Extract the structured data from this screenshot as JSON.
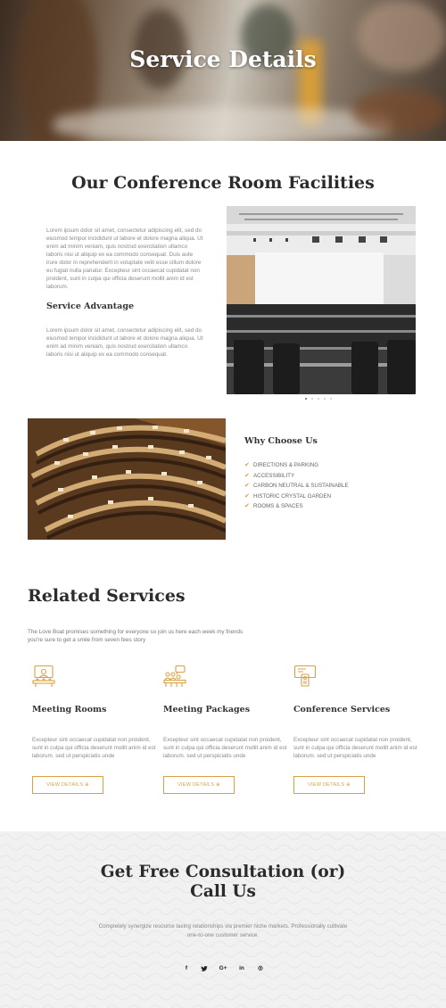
{
  "hero": {
    "title": "Service Details"
  },
  "facilities": {
    "title": "Our Conference Room Facilities",
    "intro": "Lorem ipsum dolor sit amet, consectetur adipiscing elit, sed do eiusmod tempor incididunt ut labore et dolore magna aliqua. Ut enim ad minim veniam, quis nostrud exercitation ullamco laboris nisi ut aliquip ex ea commodo consequat. Duis aute irure dolor in reprehenderit in voluptate velit esse cillum dolore eu fugiat nulla pariatur. Excepteur sint occaecat cupidatat non proident, sunt in culpa qui officia deserunt mollit anim id est laborum.",
    "advantage_title": "Service Advantage",
    "advantage_text": "Lorem ipsum dolor sit amet, consectetur adipiscing elit, sed do eiusmod tempor incididunt ut labore et dolore magna aliqua. Ut enim ad minim veniam, quis nostrud exercitation ullamco laboris nisi ut aliquip ex ea commodo consequat.",
    "slider_dots": 5,
    "slider_active": 0
  },
  "why": {
    "title": "Why Choose Us",
    "items": [
      "DIRECTIONS & PARKING",
      "ACCESSIBILITY",
      "CARBON NEUTRAL & SUSTAINABLE",
      "HISTORIC CRYSTAL GARDEN",
      "ROOMS & SPACES"
    ]
  },
  "related": {
    "title": "Related Services",
    "intro": "The Love Boat promises something for everyone so join us here each week my friends you're sure to get a smile from seven fees story",
    "cards": [
      {
        "icon": "meeting-room-icon",
        "title": "Meeting Rooms",
        "text": "Excepteur sint occaecat cupidatat non proident, sunt in culpa qui officia deserunt mollit anim id est laborum. sed ut perspiciatis unde",
        "button": "VIEW DETAILS ⊕"
      },
      {
        "icon": "meeting-packages-icon",
        "title": "Meeting Packages",
        "text": "Excepteur sint occaecat cupidatat non proident, sunt in culpa qui officia deserunt mollit anim id est laborum. sed ut perspiciatis unde",
        "button": "VIEW DETAILS ⊕"
      },
      {
        "icon": "conference-services-icon",
        "title": "Conference Services",
        "text": "Excepteur sint occaecat cupidatat non proident, sunt in culpa qui officia deserunt mollit anim id est laborum. sed ut perspiciatis unde",
        "button": "VIEW DETAILS ⊕"
      }
    ]
  },
  "consultation": {
    "title_line1": "Get Free Consultation (or)",
    "title_line2": "Call Us",
    "text": "Completely synergize resource taxing relationships via premier niche markets. Professionally cultivate one-to-one customer service."
  },
  "social": [
    {
      "icon": "facebook-icon",
      "glyph": "f"
    },
    {
      "icon": "twitter-icon",
      "glyph": "𝕥"
    },
    {
      "icon": "google-plus-icon",
      "glyph": "G+"
    },
    {
      "icon": "linkedin-icon",
      "glyph": "in"
    },
    {
      "icon": "instagram-icon",
      "glyph": "◎"
    }
  ],
  "colors": {
    "accent": "#d9a145",
    "heading": "#2b2b2b",
    "body_text": "#8a8a8a",
    "consult_bg": "#f1f1f1"
  }
}
